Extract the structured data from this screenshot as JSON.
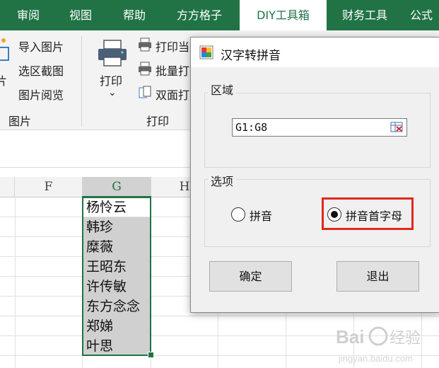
{
  "ribbon_tabs": [
    "审阅",
    "视图",
    "帮助",
    "方方格子",
    "DIY工具箱",
    "财务工具",
    "公式"
  ],
  "active_tab_index": 4,
  "ribbon": {
    "image_group": {
      "partial_label": "片",
      "items": [
        "导入图片",
        "选区截图",
        "图片阅览"
      ],
      "group_label": "图片"
    },
    "print_group": {
      "print_label": "打印",
      "dropdown_glyph": "⌄",
      "items": [
        "打印当",
        "批量打",
        "双面打"
      ],
      "group_label": "打印"
    }
  },
  "grid": {
    "columns": [
      "F",
      "G",
      "H"
    ],
    "selected_column": "G",
    "cells": [
      "杨怜云",
      "韩珍",
      "糜薇",
      "王昭东",
      "许传敏",
      "东方念念",
      "郑娣",
      "叶思"
    ]
  },
  "dialog": {
    "title": "汉字转拼音",
    "range_group_label": "区域",
    "range_value": "G1:G8",
    "options_group_label": "选项",
    "options": [
      {
        "label": "拼音",
        "selected": false
      },
      {
        "label": "拼音首字母",
        "selected": true
      }
    ],
    "ok_label": "确定",
    "exit_label": "退出"
  },
  "colors": {
    "excel_green": "#217346",
    "highlight_red": "#e0291e",
    "selection_gray": "#d0d0d0"
  }
}
